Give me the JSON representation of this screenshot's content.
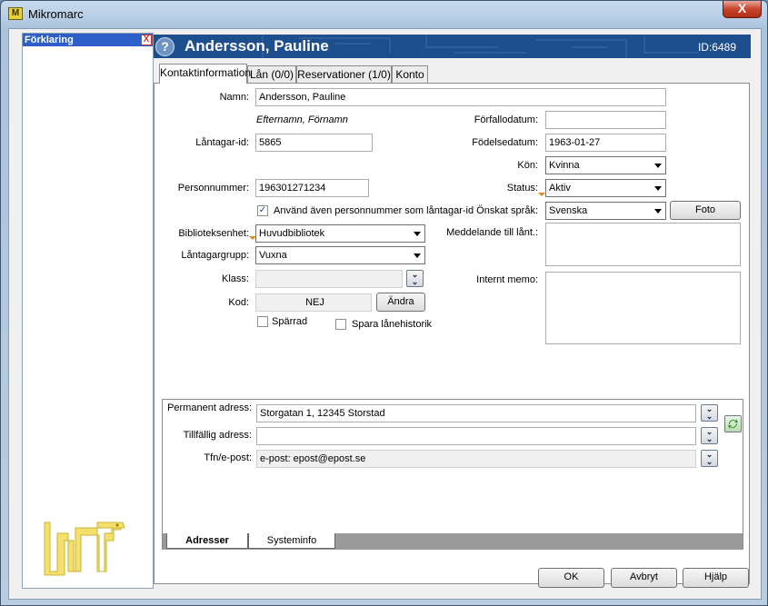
{
  "window": {
    "title": "Mikromarc",
    "close_label": "X",
    "app_icon": "M"
  },
  "left_panel": {
    "title": "Förklaring",
    "close_label": "X"
  },
  "banner": {
    "name": "Andersson, Pauline",
    "id": "ID:6489",
    "help_label": "?"
  },
  "tabs": [
    {
      "label": "Kontaktinformation",
      "active": true
    },
    {
      "label": "Lån (0/0)"
    },
    {
      "label": "Reservationer (1/0)"
    },
    {
      "label": "Konto"
    }
  ],
  "form": {
    "namn_label": "Namn:",
    "namn_value": "Andersson, Pauline",
    "namn_hint": "Efternamn, Förnamn",
    "lantagar_id_label": "Låntagar-id:",
    "lantagar_id_value": "5865",
    "personnummer_label": "Personnummer:",
    "personnummer_value": "196301271234",
    "use_pnr_label": "Använd även personnummer som låntagar-id",
    "use_pnr_checked": true,
    "biblioteksenhet_label": "Biblioteksenhet:",
    "biblioteksenhet_value": "Huvudbibliotek",
    "lantagargrupp_label": "Låntagargrupp:",
    "lantagargrupp_value": "Vuxna",
    "klass_label": "Klass:",
    "klass_value": "",
    "kod_label": "Kod:",
    "kod_value": "NEJ",
    "andra_label": "Ändra",
    "sparrad_label": "Spärrad",
    "spara_historik_label": "Spara lånehistorik",
    "forfallodatum_label": "Förfallodatum:",
    "forfallodatum_value": "",
    "fodelsedatum_label": "Födelsedatum:",
    "fodelsedatum_value": "1963-01-27",
    "kon_label": "Kön:",
    "kon_value": "Kvinna",
    "status_label": "Status:",
    "status_value": "Aktiv",
    "sprak_label": "Önskat språk:",
    "sprak_value": "Svenska",
    "foto_label": "Foto",
    "meddelande_label": "Meddelande till lånt.:",
    "memo_label": "Internt memo:"
  },
  "address": {
    "permanent_label": "Permanent adress:",
    "permanent_value": "Storgatan 1, 12345 Storstad",
    "tillfallig_label": "Tillfällig adress:",
    "tillfallig_value": "",
    "tfn_label": "Tfn/e-post:",
    "tfn_value": "e-post: epost@epost.se",
    "tabs": [
      {
        "label": "Adresser",
        "active": true
      },
      {
        "label": "Systeminfo"
      }
    ]
  },
  "footer": {
    "ok": "OK",
    "avbryt": "Avbryt",
    "hjalp": "Hjälp"
  },
  "colors": {
    "banner": "#1d4f8f",
    "accent": "#2c5fc7",
    "marker": "#e08a1a",
    "logo": "#f4e06a"
  }
}
